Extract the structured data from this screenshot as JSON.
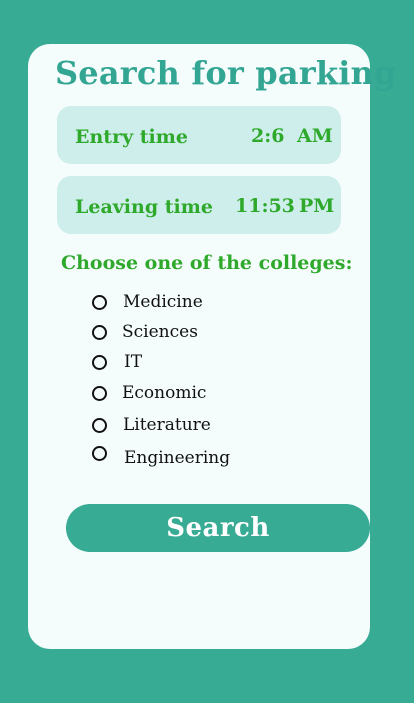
{
  "title": "Search for parking",
  "entry": {
    "label": "Entry time",
    "time": "2:6",
    "period": "AM"
  },
  "leaving": {
    "label": "Leaving time",
    "time": "11:53",
    "period": "PM"
  },
  "colleges": {
    "prompt": "Choose one of the colleges:",
    "options": [
      "Medicine",
      "Sciences",
      "IT",
      "Economic",
      "Literature",
      "Engineering"
    ]
  },
  "search_button": {
    "label": "Search"
  },
  "colors": {
    "background": "#38ab94",
    "card": "#f5fcfc",
    "title": "#33a693",
    "time_box": "#cdeeea",
    "green_text": "#2fa92b"
  }
}
